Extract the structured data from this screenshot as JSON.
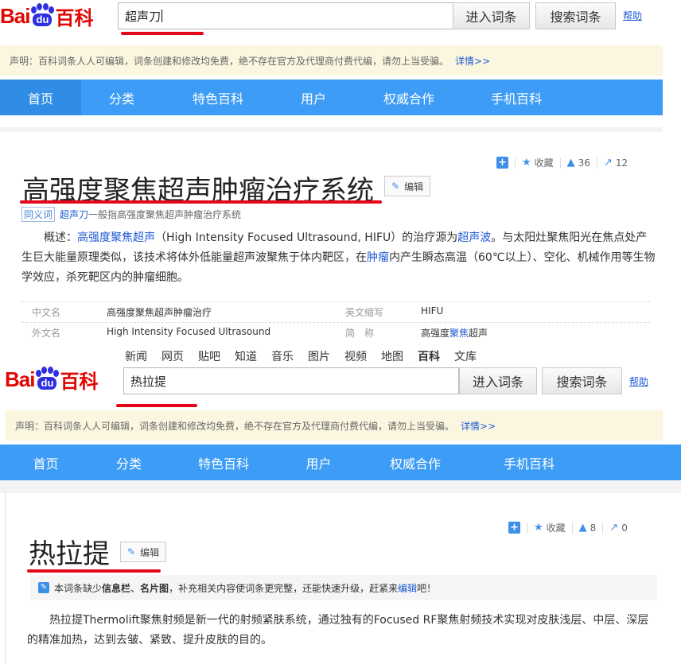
{
  "shot1": {
    "logo": {
      "bai": "Bai",
      "du": "du",
      "baike": "百科"
    },
    "search": {
      "value": "超声刀"
    },
    "buttons": {
      "enter": "进入词条",
      "search": "搜索词条",
      "help": "帮助"
    },
    "notice": {
      "text": "声明：百科词条人人可编辑，词条创建和修改均免费，绝不存在官方及代理商付费代编，请勿上当受骗。",
      "more": "详情>>"
    },
    "nav": [
      "首页",
      "分类",
      "特色百科",
      "用户",
      "权威合作",
      "手机百科"
    ],
    "actions": {
      "collect": "收藏",
      "likes": "36",
      "shares": "12"
    },
    "title": "高强度聚焦超声肿瘤治疗系统",
    "edit": "编辑",
    "synonym": {
      "tag": "同义词",
      "link": "超声刀",
      "text": "一般指高强度聚焦超声肿瘤治疗系统"
    },
    "summary": {
      "p1": "概述：",
      "l1": "高强度聚焦超声",
      "p2": "（High Intensity Focused Ultrasound, HIFU）的治疗源为",
      "l2": "超声波",
      "p3": "。与太阳灶聚焦阳光在焦点处产生巨大能量原理类似，该技术将体外低能量超声波聚焦于体内靶区，在",
      "l3": "肿瘤",
      "p4": "内产生瞬态高温（60℃以上）、空化、机械作用等生物学效应，杀死靶区内的肿瘤细胞。"
    },
    "info": {
      "cn_label": "中文名",
      "cn_value": "高强度聚焦超声肿瘤治疗",
      "abbr_label": "英文缩写",
      "abbr_value": "HIFU",
      "fn_label": "外文名",
      "fn_value": "High Intensity Focused Ultrasound",
      "short_label": "简　称",
      "short_a": "高强度",
      "short_link": "聚焦",
      "short_b": "超声"
    }
  },
  "shot2": {
    "topnav": [
      "新闻",
      "网页",
      "贴吧",
      "知道",
      "音乐",
      "图片",
      "视频",
      "地图",
      "百科",
      "文库"
    ],
    "logo": {
      "bai": "Bai",
      "du": "du",
      "baike": "百科"
    },
    "search": {
      "value": "热拉提"
    },
    "buttons": {
      "enter": "进入词条",
      "search": "搜索词条",
      "help": "帮助"
    },
    "notice": {
      "text": "声明：百科词条人人可编辑，词条创建和修改均免费，绝不存在官方及代理商付费代编，请勿上当受骗。",
      "more": "详情>>"
    },
    "nav": [
      "首页",
      "分类",
      "特色百科",
      "用户",
      "权威合作",
      "手机百科"
    ],
    "actions": {
      "collect": "收藏",
      "likes": "8",
      "shares": "0"
    },
    "title": "热拉提",
    "edit": "编辑",
    "tip": {
      "a": "本词条缺少",
      "b1": "信息栏",
      "c": "、",
      "b2": "名片图",
      "d": "，补充相关内容使词条更完整，还能快速升级，赶紧来",
      "link": "编辑",
      "e": "吧！"
    },
    "summary": "热拉提Thermolift聚焦射频是新一代的射频紧肤系统，通过独有的Focused RF聚焦射频技术实现对皮肤浅层、中层、深层的精准加热，达到去皱、紧致、提升皮肤的目的。"
  }
}
